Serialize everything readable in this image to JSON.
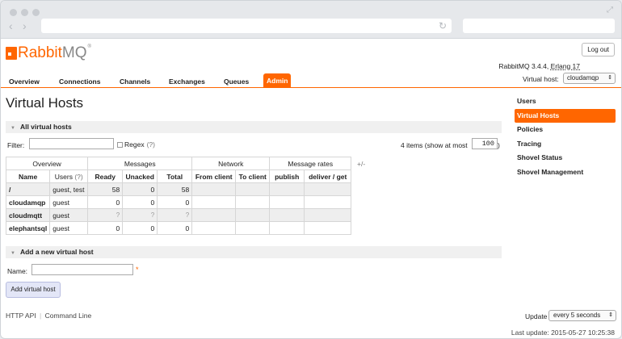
{
  "browser": {
    "back_icon": "chevron-left-icon",
    "forward_icon": "chevron-right-icon",
    "reload_icon": "reload-icon"
  },
  "header": {
    "logo_rabbit": "Rabbit",
    "logo_mq": "MQ",
    "logo_reg": "®",
    "logout_label": "Log out",
    "version_text": "RabbitMQ 3.4.4, ",
    "erlang_text": "Erlang 17",
    "vhost_label": "Virtual host:",
    "vhost_selected": "cloudamqp"
  },
  "nav": {
    "tabs": [
      {
        "label": "Overview"
      },
      {
        "label": "Connections"
      },
      {
        "label": "Channels"
      },
      {
        "label": "Exchanges"
      },
      {
        "label": "Queues"
      },
      {
        "label": "Admin",
        "active": true
      }
    ]
  },
  "page": {
    "title": "Virtual Hosts"
  },
  "sidebar": {
    "items": [
      {
        "label": "Users"
      },
      {
        "label": "Virtual Hosts",
        "active": true
      },
      {
        "label": "Policies"
      },
      {
        "label": "Tracing"
      },
      {
        "label": "Shovel Status"
      },
      {
        "label": "Shovel Management"
      }
    ]
  },
  "all_vhosts": {
    "section_title": "All virtual hosts",
    "filter_label": "Filter:",
    "filter_value": "",
    "regex_label": "Regex",
    "regex_help": "(?)",
    "items_text": "4 items (show at most",
    "page_size": "100",
    "paren_close": ")",
    "plus_minus": "+/-",
    "group_headers": [
      "Overview",
      "Messages",
      "Network",
      "Message rates"
    ],
    "columns": [
      "Name",
      "Users",
      "(?)",
      "Ready",
      "Unacked",
      "Total",
      "From client",
      "To client",
      "publish",
      "deliver / get"
    ],
    "rows": [
      {
        "name": "/",
        "users": "guest, test",
        "ready": "58",
        "unacked": "0",
        "total": "58"
      },
      {
        "name": "cloudamqp",
        "users": "guest",
        "ready": "0",
        "unacked": "0",
        "total": "0"
      },
      {
        "name": "cloudmqtt",
        "users": "guest",
        "ready": "?",
        "unacked": "?",
        "total": "?"
      },
      {
        "name": "elephantsql",
        "users": "guest",
        "ready": "0",
        "unacked": "0",
        "total": "0"
      }
    ]
  },
  "add_vhost": {
    "section_title": "Add a new virtual host",
    "name_label": "Name:",
    "name_value": "",
    "required_mark": "*",
    "button_label": "Add virtual host"
  },
  "footer": {
    "http_api": "HTTP API",
    "separator": "|",
    "command_line": "Command Line",
    "update_label": "Update",
    "update_selected": "every 5 seconds",
    "last_update": "Last update: 2015-05-27 10:25:38"
  },
  "colors": {
    "accent": "#ff6600"
  }
}
